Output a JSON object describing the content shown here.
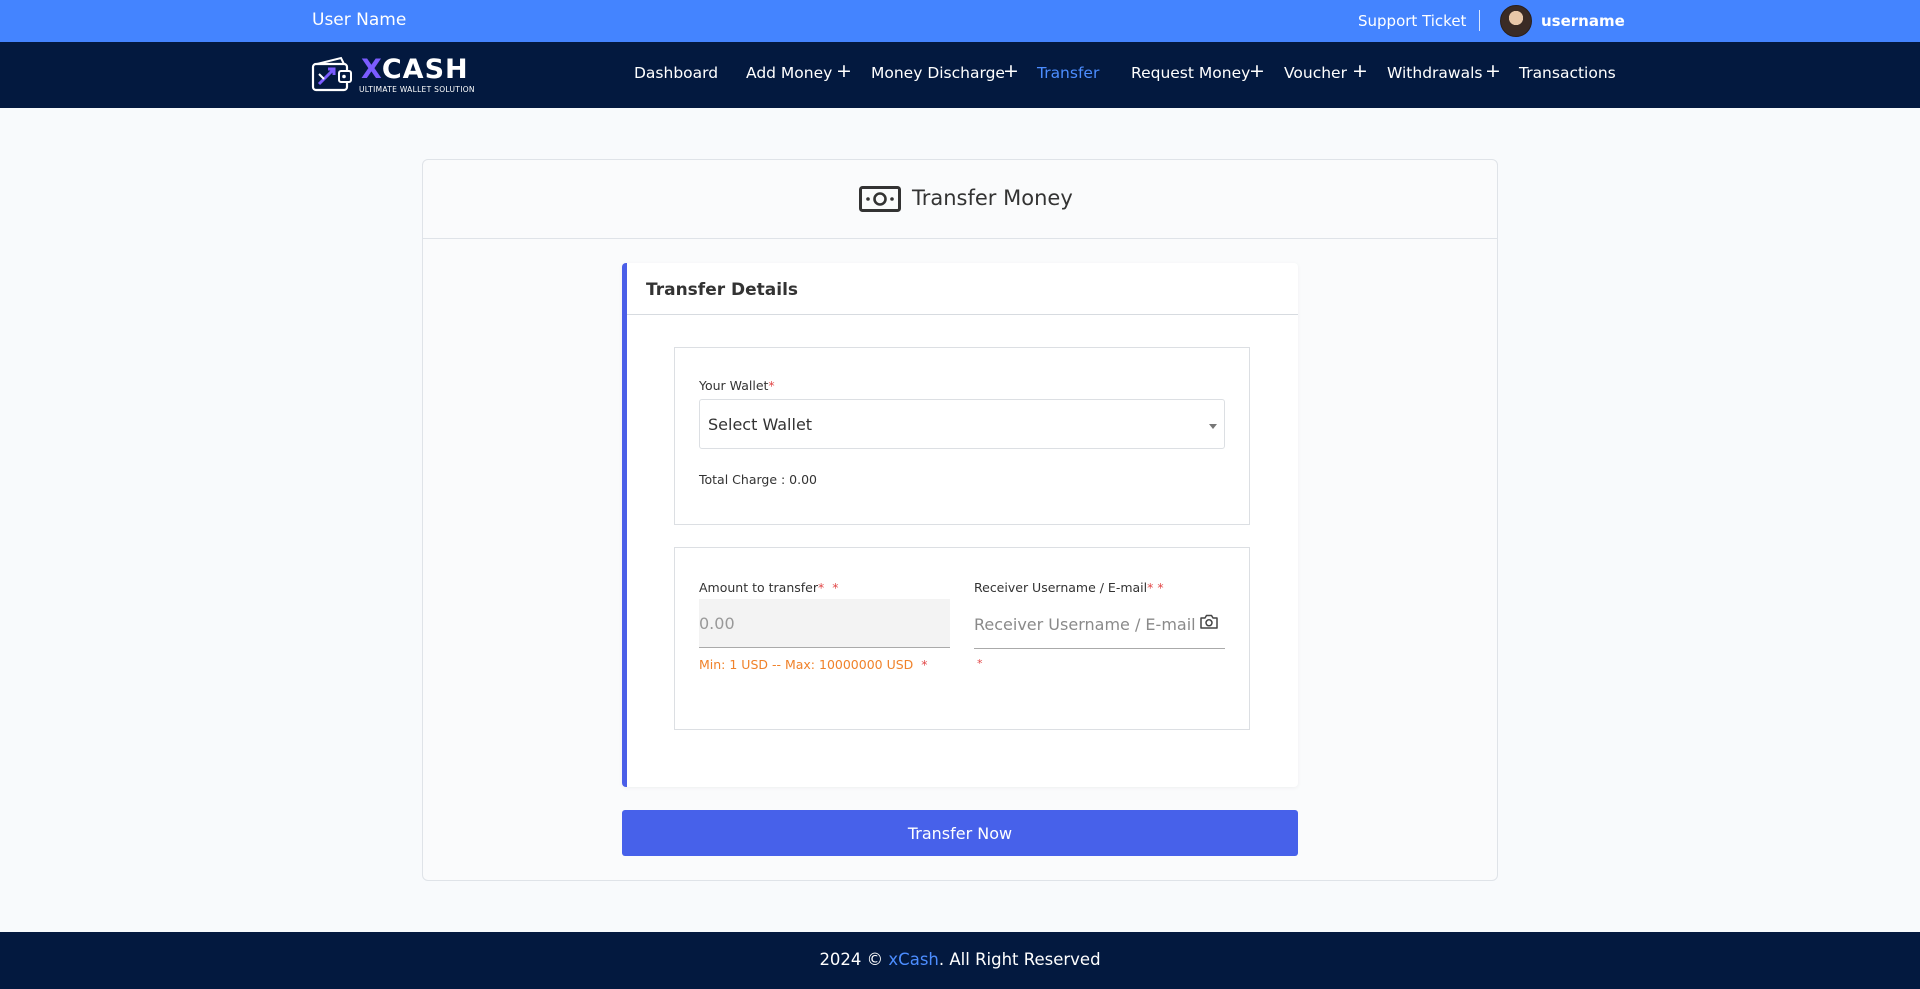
{
  "topbar": {
    "user_name": "User Name",
    "support_label": "Support Ticket",
    "username": "username"
  },
  "brand": {
    "logo_main": "CASH",
    "logo_x": "X",
    "tagline": "ULTIMATE WALLET SOLUTION",
    "accent": "#7b5cff"
  },
  "nav": {
    "items": [
      {
        "label": "Dashboard",
        "has_plus": false,
        "active": false
      },
      {
        "label": "Add Money",
        "has_plus": true,
        "active": false
      },
      {
        "label": "Money Discharge",
        "has_plus": true,
        "active": false
      },
      {
        "label": "Transfer",
        "has_plus": false,
        "active": true
      },
      {
        "label": "Request Money",
        "has_plus": true,
        "active": false
      },
      {
        "label": "Voucher",
        "has_plus": true,
        "active": false
      },
      {
        "label": "Withdrawals",
        "has_plus": true,
        "active": false
      },
      {
        "label": "Transactions",
        "has_plus": false,
        "active": false
      }
    ],
    "plus_symbol": "+"
  },
  "page": {
    "title": "Transfer Money",
    "icon": "money-icon"
  },
  "details": {
    "title": "Transfer Details",
    "wallet_label": "Your Wallet",
    "required_mark": "*",
    "wallet_value": "Select Wallet",
    "total_charge": "Total Charge : 0.00",
    "amount_label": "Amount to transfer",
    "amount_placeholder": "0.00",
    "minmax": "Min: 1 USD -- Max: 10000000 USD",
    "receiver_label": "Receiver Username / E-mail",
    "receiver_placeholder": "Receiver Username / E-mail",
    "receiver_icon": "camera-icon"
  },
  "actions": {
    "transfer_label": "Transfer Now"
  },
  "footer": {
    "prefix": "2024 © ",
    "brand": "xCash",
    "suffix": ". All Right Reserved"
  },
  "colors": {
    "topbar": "#4484ff",
    "navbar": "#03193f",
    "active": "#4c8dff",
    "button": "#4761ea",
    "warning": "#f0822a",
    "required": "#e24848"
  }
}
